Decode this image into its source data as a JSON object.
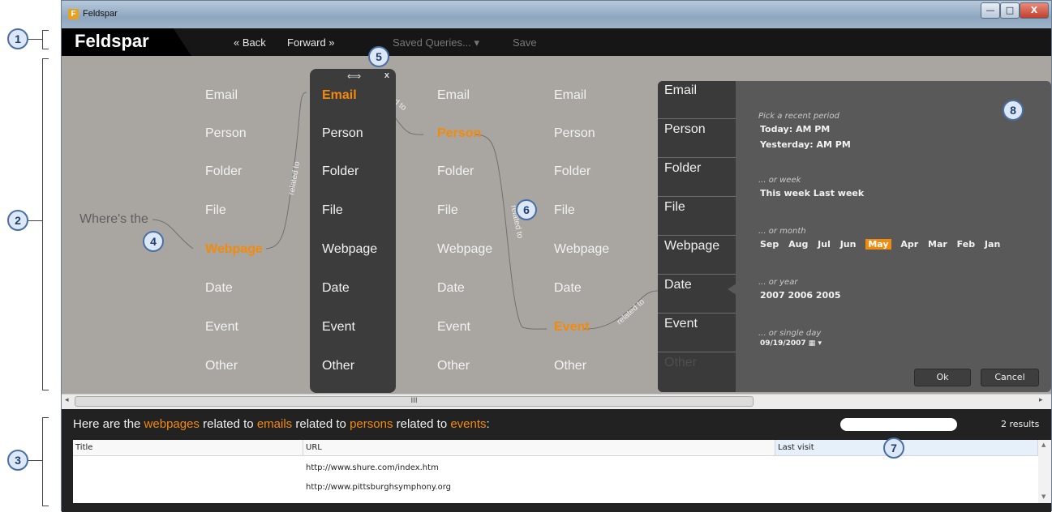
{
  "annotations": [
    "1",
    "2",
    "3",
    "4",
    "5",
    "6",
    "7",
    "8"
  ],
  "window": {
    "title": "Feldspar",
    "app_icon_letter": "F",
    "controls": {
      "minimize": "—",
      "maximize": "□",
      "close": "X"
    }
  },
  "toolbar": {
    "logo": "Feldspar",
    "back": "« Back",
    "forward": "Forward »",
    "saved_queries": "Saved Queries... ▾",
    "save": "Save"
  },
  "query": {
    "prompt": "Where's the",
    "relation": "related to",
    "types": [
      "Email",
      "Person",
      "Folder",
      "File",
      "Webpage",
      "Date",
      "Event",
      "Other"
    ],
    "column1_selected": "Webpage",
    "column2_selected": "Email",
    "column3_selected": "Person",
    "column4_selected": "Event",
    "close_label": "x",
    "resize_glyph": "⟺"
  },
  "date_picker": {
    "tabs": [
      "Email",
      "Person",
      "Folder",
      "File",
      "Webpage",
      "Date",
      "Event",
      "Other"
    ],
    "selected_tab": "Date",
    "recent_header": "Pick a recent period",
    "today": "Today:  AM  PM",
    "yesterday": "Yesterday:  AM  PM",
    "week_header": "... or week",
    "weeks": "This week  Last week",
    "month_header": "... or month",
    "months": [
      "Sep",
      "Aug",
      "Jul",
      "Jun",
      "May",
      "Apr",
      "Mar",
      "Feb",
      "Jan"
    ],
    "selected_month": "May",
    "year_header": "... or year",
    "years": "2007  2006  2005",
    "day_header": "... or single day",
    "day_value": "09/19/2007 ▦ ▾",
    "ok": "Ok",
    "cancel": "Cancel"
  },
  "scrollbar": {
    "thumb_grip": "III",
    "left_arrow": "◂",
    "right_arrow": "▸"
  },
  "results": {
    "summary_prefix": "Here are the ",
    "t1": "webpages",
    "s1": " related to ",
    "t2": "emails",
    "s2": " related to ",
    "t3": "persons",
    "s3": " related to ",
    "t4": "events",
    "summary_suffix": ":",
    "count": "2 results",
    "columns": [
      "Title",
      "URL",
      "Last visit"
    ],
    "rows": [
      {
        "title": "",
        "url": "http://www.shure.com/index.htm",
        "last_visit": ""
      },
      {
        "title": "",
        "url": "http://www.pittsburghsymphony.org",
        "last_visit": ""
      }
    ]
  },
  "colors": {
    "accent": "#f28a0c",
    "canvas": "#a9a6a2",
    "panel": "#3c3c3c"
  }
}
